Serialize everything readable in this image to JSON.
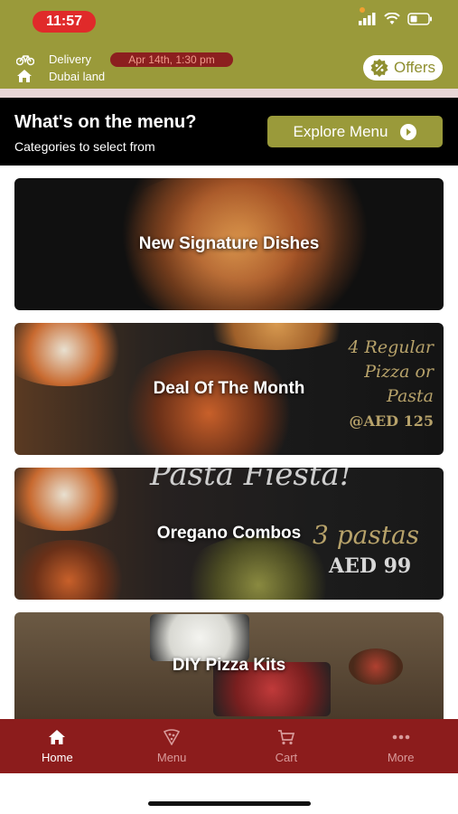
{
  "status_bar": {
    "time": "11:57"
  },
  "header": {
    "delivery_label": "Delivery",
    "location": "Dubai land",
    "date_time": "Apr 14th, 1:30 pm",
    "offers_label": "Offers"
  },
  "menu_section": {
    "title": "What's on the menu?",
    "subtitle": "Categories to select from",
    "explore_label": "Explore Menu"
  },
  "categories": [
    {
      "label": "New Signature Dishes"
    },
    {
      "label": "Deal Of The Month",
      "promo": [
        "4 Regular",
        "Pizza or",
        "Pasta",
        "@AED 125"
      ]
    },
    {
      "label": "Oregano Combos",
      "promo": [
        "Pasta Fiesta!",
        "3 pastas",
        "AED 99"
      ]
    },
    {
      "label": "DIY Pizza Kits"
    }
  ],
  "tab_bar": {
    "tabs": [
      {
        "label": "Home",
        "icon": "home-icon",
        "active": true
      },
      {
        "label": "Menu",
        "icon": "pizza-slice-icon",
        "active": false
      },
      {
        "label": "Cart",
        "icon": "cart-icon",
        "active": false
      },
      {
        "label": "More",
        "icon": "more-dots-icon",
        "active": false
      }
    ]
  },
  "colors": {
    "olive": "#9a9a3a",
    "maroon": "#8c1c1c",
    "black": "#000000"
  }
}
